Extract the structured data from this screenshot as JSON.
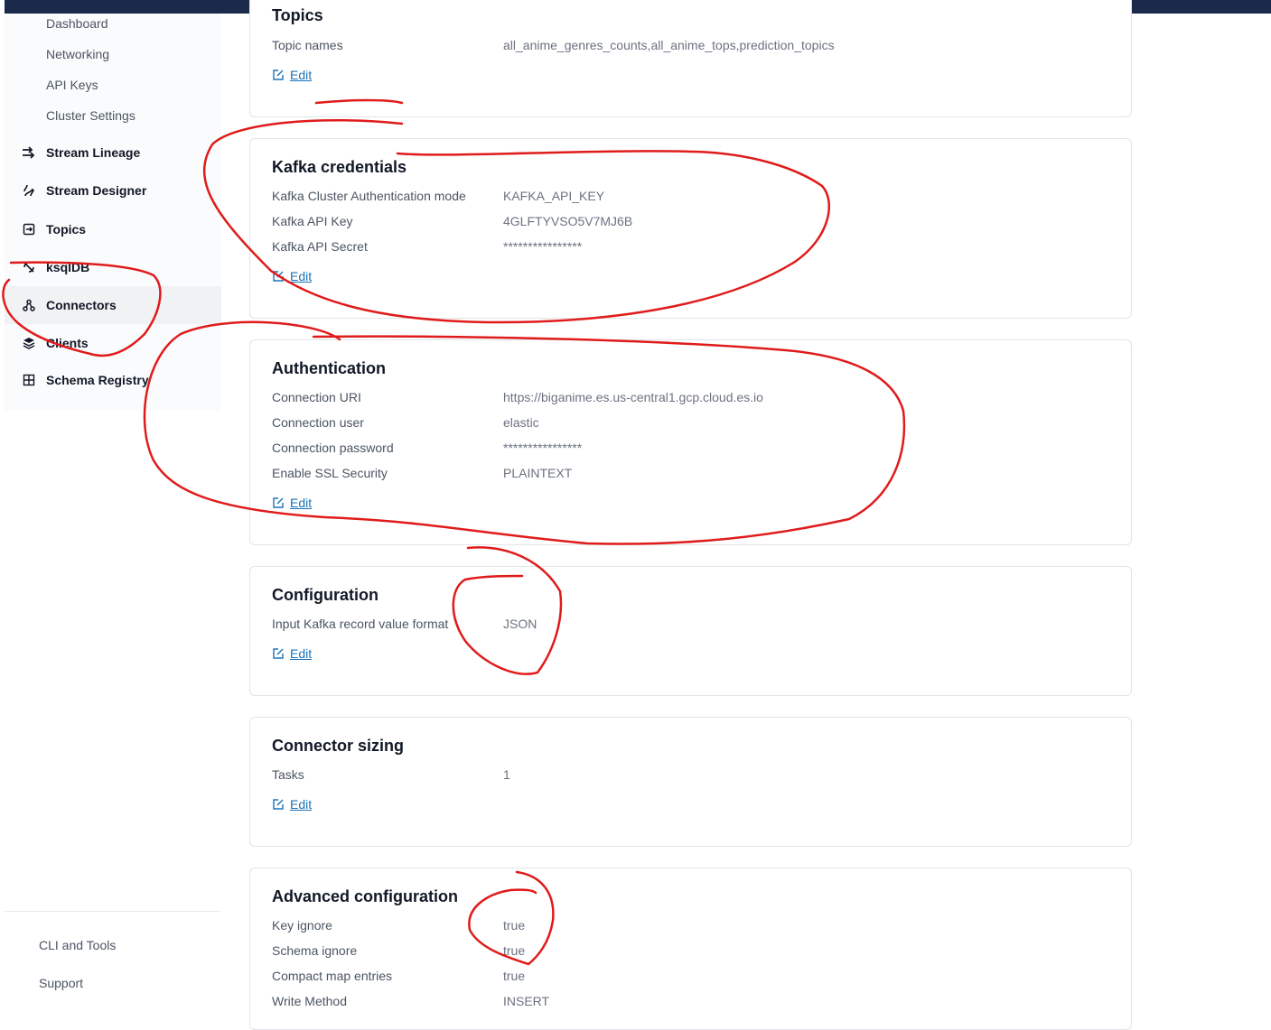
{
  "sidebar": {
    "sub_items": [
      "Dashboard",
      "Networking",
      "API Keys",
      "Cluster Settings"
    ],
    "items": [
      {
        "label": "Stream Lineage",
        "icon": "stream-lineage-icon"
      },
      {
        "label": "Stream Designer",
        "icon": "stream-designer-icon"
      },
      {
        "label": "Topics",
        "icon": "topics-icon"
      },
      {
        "label": "ksqlDB",
        "icon": "ksqldb-icon"
      },
      {
        "label": "Connectors",
        "icon": "connectors-icon",
        "active": true
      },
      {
        "label": "Clients",
        "icon": "clients-icon"
      },
      {
        "label": "Schema Registry",
        "icon": "schema-registry-icon"
      }
    ],
    "bottom": [
      "CLI and Tools",
      "Support"
    ]
  },
  "edit_label": "Edit",
  "sections": {
    "topics": {
      "title": "Topics",
      "rows": [
        {
          "label": "Topic names",
          "value": "all_anime_genres_counts,all_anime_tops,prediction_topics"
        }
      ]
    },
    "kafka": {
      "title": "Kafka credentials",
      "rows": [
        {
          "label": "Kafka Cluster Authentication mode",
          "value": "KAFKA_API_KEY"
        },
        {
          "label": "Kafka API Key",
          "value": "4GLFTYVSO5V7MJ6B"
        },
        {
          "label": "Kafka API Secret",
          "value": "****************"
        }
      ]
    },
    "auth": {
      "title": "Authentication",
      "rows": [
        {
          "label": "Connection URI",
          "value": "https://biganime.es.us-central1.gcp.cloud.es.io"
        },
        {
          "label": "Connection user",
          "value": "elastic"
        },
        {
          "label": "Connection password",
          "value": "****************"
        },
        {
          "label": "Enable SSL Security",
          "value": "PLAINTEXT"
        }
      ]
    },
    "config": {
      "title": "Configuration",
      "rows": [
        {
          "label": "Input Kafka record value format",
          "value": "JSON"
        }
      ]
    },
    "sizing": {
      "title": "Connector sizing",
      "rows": [
        {
          "label": "Tasks",
          "value": "1"
        }
      ]
    },
    "advanced": {
      "title": "Advanced configuration",
      "rows": [
        {
          "label": "Key ignore",
          "value": "true"
        },
        {
          "label": "Schema ignore",
          "value": "true"
        },
        {
          "label": "Compact map entries",
          "value": "true"
        },
        {
          "label": "Write Method",
          "value": "INSERT"
        }
      ]
    }
  },
  "colors": {
    "topbar": "#1b2a4a",
    "link": "#1a73b8",
    "annotation": "#e01b1b"
  }
}
